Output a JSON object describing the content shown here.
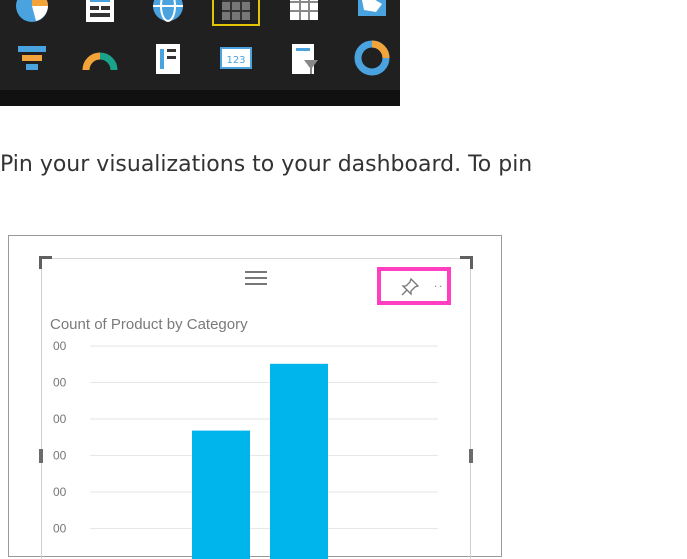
{
  "visualizations_pane": {
    "row1": [
      {
        "icon": "pie-chart-icon"
      },
      {
        "icon": "table-report-icon"
      },
      {
        "icon": "globe-map-icon"
      },
      {
        "icon": "table-grid-icon",
        "selected": true
      },
      {
        "icon": "matrix-icon"
      },
      {
        "icon": "filled-map-icon"
      }
    ],
    "row2": [
      {
        "icon": "funnel-icon"
      },
      {
        "icon": "gauge-icon"
      },
      {
        "icon": "card-icon"
      },
      {
        "icon": "number-card-icon"
      },
      {
        "icon": "slicer-icon"
      },
      {
        "icon": "donut-icon"
      }
    ],
    "selected_color": "#e2c400"
  },
  "instruction": {
    "text": "Pin your visualizations to your dashboard. To pin"
  },
  "visual_card": {
    "title": "Count of Product by Category",
    "pin_highlight_color": "#ff3fbf",
    "bar_color": "#00b4ec"
  },
  "chart_data": {
    "type": "bar",
    "title": "Count of Product by Category",
    "y_tick_labels": [
      "00",
      "00",
      "00",
      "00",
      "00",
      "00"
    ],
    "values": [
      0.5,
      0.76
    ],
    "value_note": "relative bar heights as fraction of visible plot area; axis labels are cropped",
    "grid": true
  }
}
